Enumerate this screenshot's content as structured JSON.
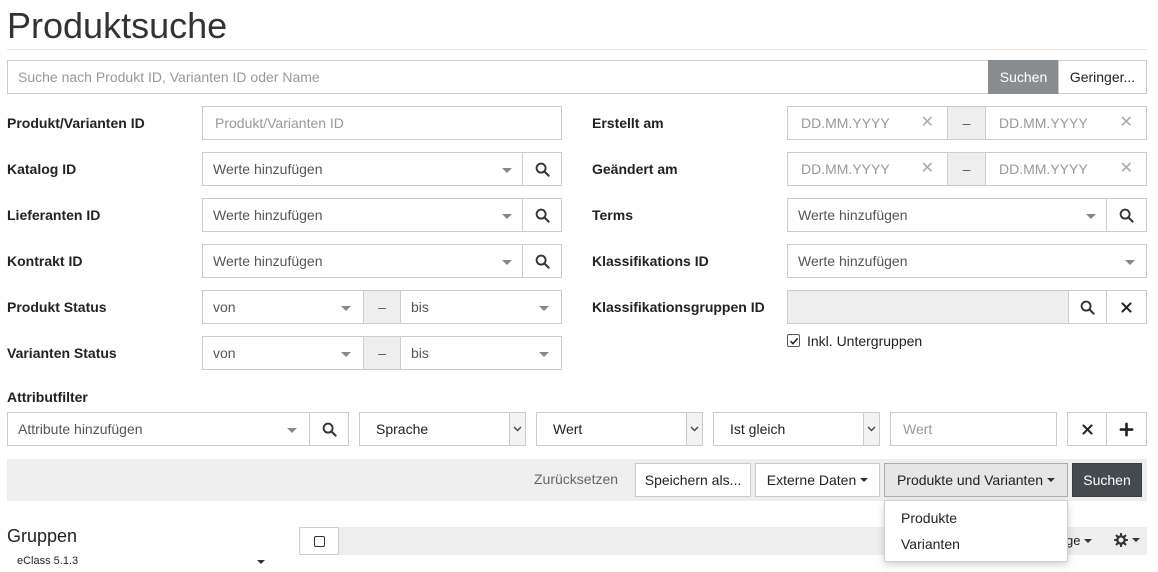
{
  "page_title": "Produktsuche",
  "search": {
    "placeholder": "Suche nach Produkt ID, Varianten ID oder Name",
    "search_button": "Suchen",
    "less_button": "Geringer..."
  },
  "left_fields": {
    "produkt_varianten_id": {
      "label": "Produkt/Varianten ID",
      "placeholder": "Produkt/Varianten ID"
    },
    "katalog_id": {
      "label": "Katalog ID",
      "placeholder": "Werte hinzufügen"
    },
    "lieferanten_id": {
      "label": "Lieferanten ID",
      "placeholder": "Werte hinzufügen"
    },
    "kontrakt_id": {
      "label": "Kontrakt ID",
      "placeholder": "Werte hinzufügen"
    },
    "produkt_status": {
      "label": "Produkt Status",
      "from": "von",
      "separator": "–",
      "to": "bis"
    },
    "varianten_status": {
      "label": "Varianten Status",
      "from": "von",
      "separator": "–",
      "to": "bis"
    }
  },
  "right_fields": {
    "erstellt_am": {
      "label": "Erstellt am",
      "from_placeholder": "DD.MM.YYYY",
      "separator": "–",
      "to_placeholder": "DD.MM.YYYY"
    },
    "geaendert_am": {
      "label": "Geändert am",
      "from_placeholder": "DD.MM.YYYY",
      "separator": "–",
      "to_placeholder": "DD.MM.YYYY"
    },
    "terms": {
      "label": "Terms",
      "placeholder": "Werte hinzufügen"
    },
    "klassifikations_id": {
      "label": "Klassifikations ID",
      "placeholder": "Werte hinzufügen"
    },
    "klassifikationsgruppen_id": {
      "label": "Klassifikationsgruppen ID",
      "checkbox_label": "Inkl. Untergruppen",
      "checkbox_checked": true
    }
  },
  "attributfilter": {
    "label": "Attributfilter",
    "attribute_placeholder": "Attribute hinzufügen",
    "language_value": "Sprache",
    "value_select": "Wert",
    "operator_value": "Ist gleich",
    "value_placeholder": "Wert"
  },
  "toolbar": {
    "reset": "Zurücksetzen",
    "save_as": "Speichern als...",
    "external_data": "Externe Daten",
    "mode": "Produkte und Varianten",
    "search": "Suchen"
  },
  "mode_menu": {
    "items": [
      "Produkte",
      "Varianten"
    ]
  },
  "groups": {
    "title": "Gruppen",
    "selected": "eClass 5.1.3"
  },
  "results_header": {
    "partial_label": "ge"
  },
  "icons": {
    "search": "search-icon",
    "clear": "close-icon",
    "remove": "remove-icon",
    "add": "plus-icon",
    "settings": "gear-icon"
  },
  "colors": {
    "primary_dark": "#454a4f",
    "search_gray": "#8a8d90",
    "toolbar_bg": "#eeeeee"
  }
}
